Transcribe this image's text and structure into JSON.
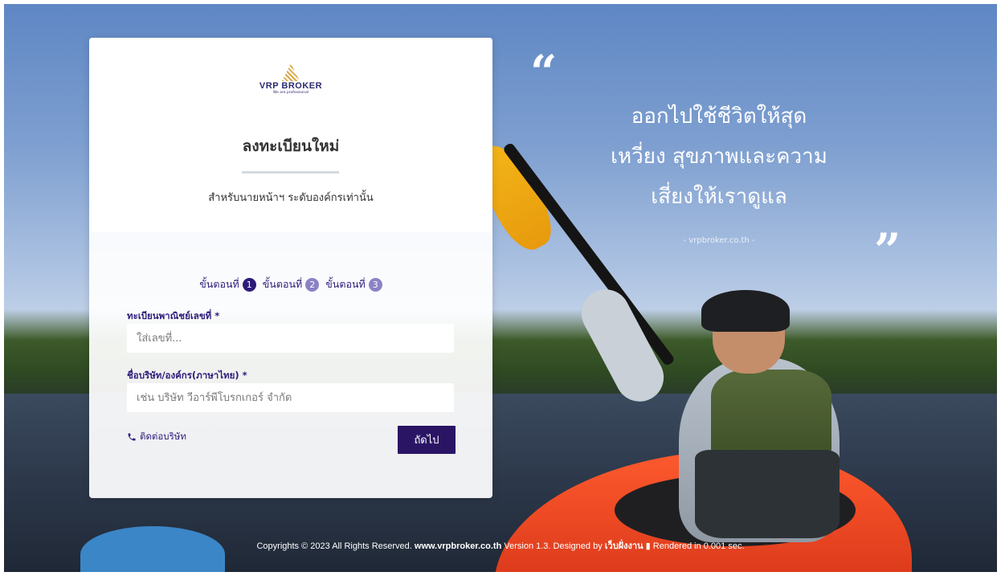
{
  "brand": {
    "name": "VRP BROKER",
    "tagline": "We are professional"
  },
  "form": {
    "title": "ลงทะเบียนใหม่",
    "subtitle": "สำหรับนายหน้าฯ ระดับองค์กรเท่านั้น",
    "steps": [
      {
        "label": "ขั้นตอนที่",
        "num": "1"
      },
      {
        "label": "ขั้นตอนที่",
        "num": "2"
      },
      {
        "label": "ขั้นตอนที่",
        "num": "3"
      }
    ],
    "reg_label": "ทะเบียนพาณิชย์เลขที่ *",
    "reg_placeholder": "ใส่เลขที่...",
    "company_label": "ชื่อบริษัท/องค์กร(ภาษาไทย) *",
    "company_placeholder": "เช่น บริษัท วีอาร์พีโบรกเกอร์ จำกัด",
    "contact_label": "ติดต่อบริษัท",
    "next_label": "ถัดไป"
  },
  "quote": {
    "open": "“",
    "lines": [
      "ออกไปใช้ชีวิตให้สุด",
      "เหวี่ยง สุขภาพและความ",
      "เสี่ยงให้เราดูแล"
    ],
    "source": "- vrpbroker.co.th -",
    "close": "”"
  },
  "footer": {
    "copyright": "Copyrights © 2023 All Rights Reserved.",
    "site": "www.vrpbroker.co.th",
    "version": "Version 1.3.",
    "designed_by": "Designed by",
    "designer": "เว็บฝั่งงาน",
    "rendered": "Rendered in 0.001 sec."
  },
  "colors": {
    "primary": "#2a1565",
    "step_inactive": "#8a82c4",
    "label": "#2d1b7a"
  }
}
